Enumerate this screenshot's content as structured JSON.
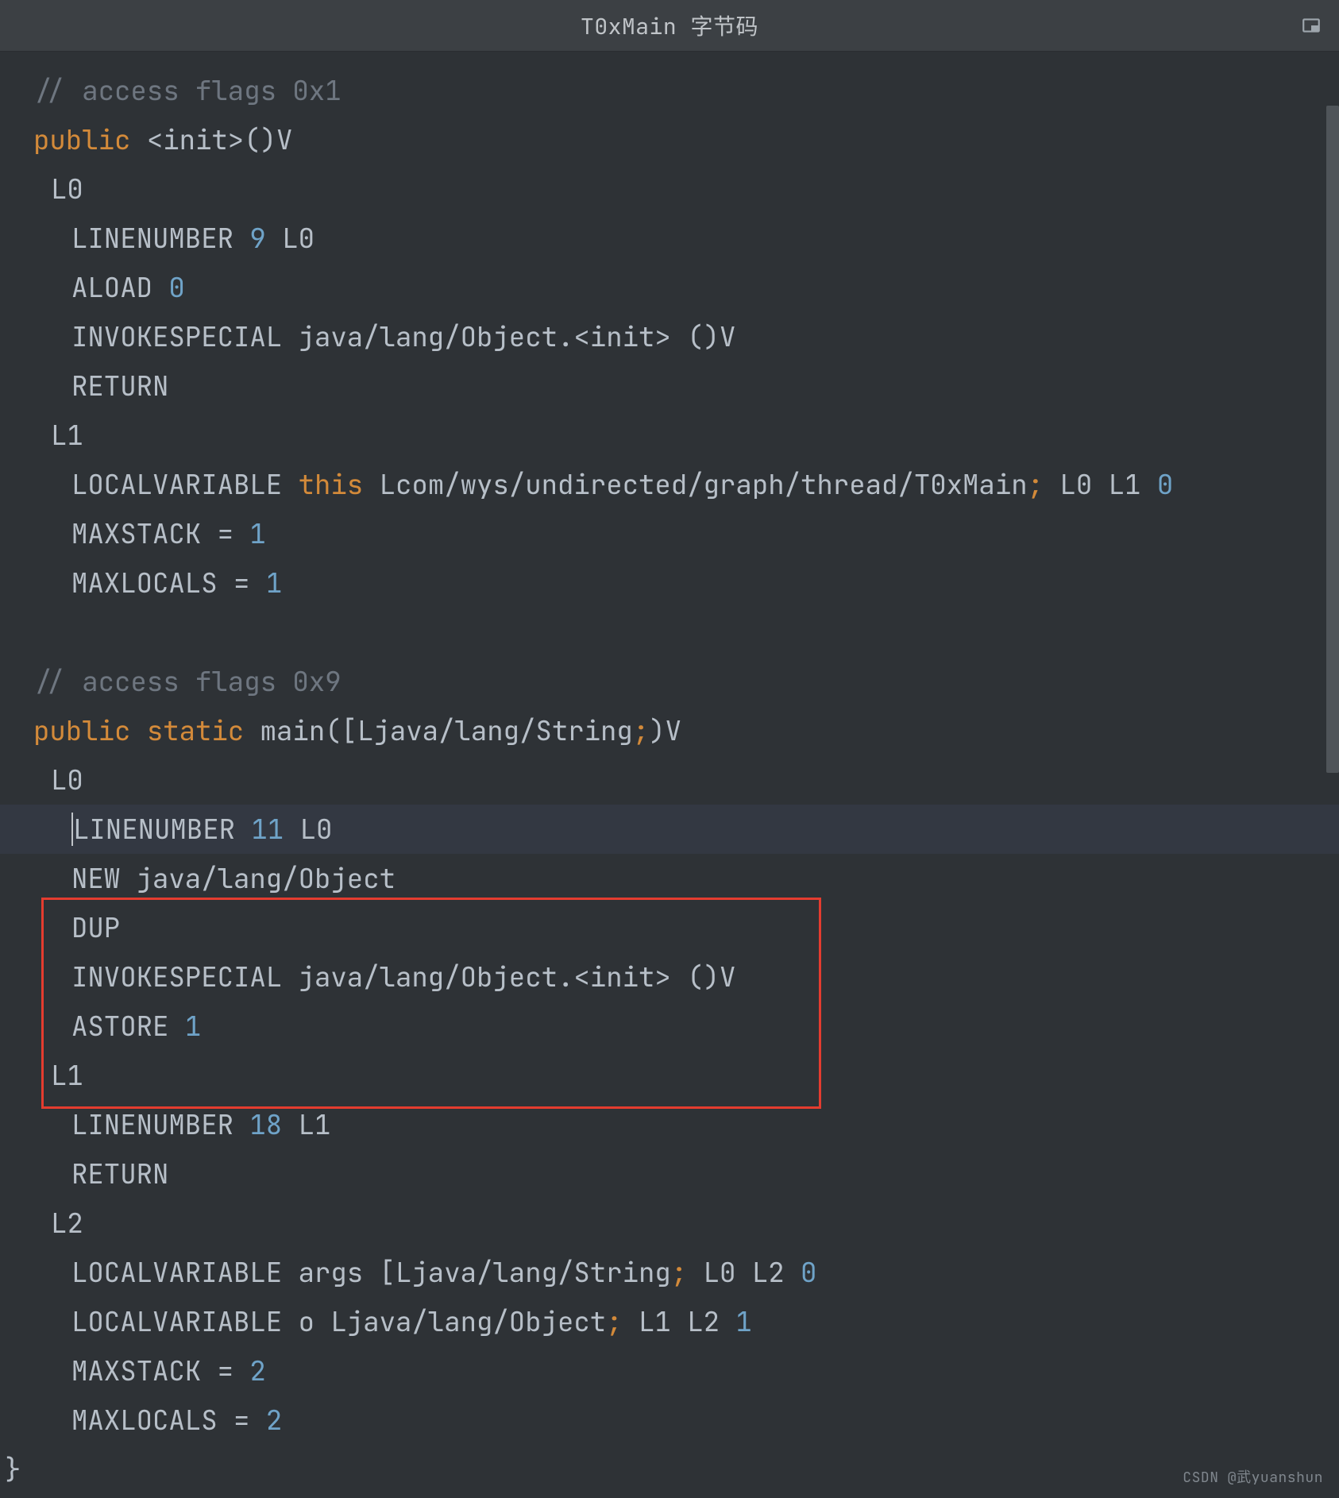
{
  "title": "T0xMain 字节码",
  "watermark": "CSDN @武yuanshun",
  "lines": {
    "l1_comment": "// access flags 0x1",
    "l2_kw": "public ",
    "l2_rest": "<init>()V",
    "l3": "L0",
    "l4_a": "LINENUMBER ",
    "l4_n": "9",
    "l4_b": " L0",
    "l5_a": "ALOAD ",
    "l5_n": "0",
    "l6": "INVOKESPECIAL java/lang/Object.<init> ()V",
    "l7": "RETURN",
    "l8": "L1",
    "l9_a": "LOCALVARIABLE ",
    "l9_this": "this",
    "l9_b": " Lcom/wys/undirected/graph/thread/T0xMain",
    "l9_p": ";",
    "l9_c": " L0 L1 ",
    "l9_n": "0",
    "l10_a": "MAXSTACK = ",
    "l10_n": "1",
    "l11_a": "MAXLOCALS = ",
    "l11_n": "1",
    "l12": "",
    "l13_comment": "// access flags 0x9",
    "l14_kw1": "public ",
    "l14_kw2": "static ",
    "l14_a": "main([Ljava/lang/String",
    "l14_p": ";",
    "l14_b": ")V",
    "l15": "L0",
    "l16_a": "LINENUMBER ",
    "l16_n": "11",
    "l16_b": " L0",
    "l17": "NEW java/lang/Object",
    "l18": "DUP",
    "l19": "INVOKESPECIAL java/lang/Object.<init> ()V",
    "l20_a": "ASTORE ",
    "l20_n": "1",
    "l21": "L1",
    "l22_a": "LINENUMBER ",
    "l22_n": "18",
    "l22_b": " L1",
    "l23": "RETURN",
    "l24": "L2",
    "l25_a": "LOCALVARIABLE args [Ljava/lang/String",
    "l25_p": ";",
    "l25_b": " L0 L2 ",
    "l25_n": "0",
    "l26_a": "LOCALVARIABLE o Ljava/lang/Object",
    "l26_p": ";",
    "l26_b": " L1 L2 ",
    "l26_n": "1",
    "l27_a": "MAXSTACK = ",
    "l27_n": "2",
    "l28_a": "MAXLOCALS = ",
    "l28_n": "2",
    "l29": "}"
  }
}
